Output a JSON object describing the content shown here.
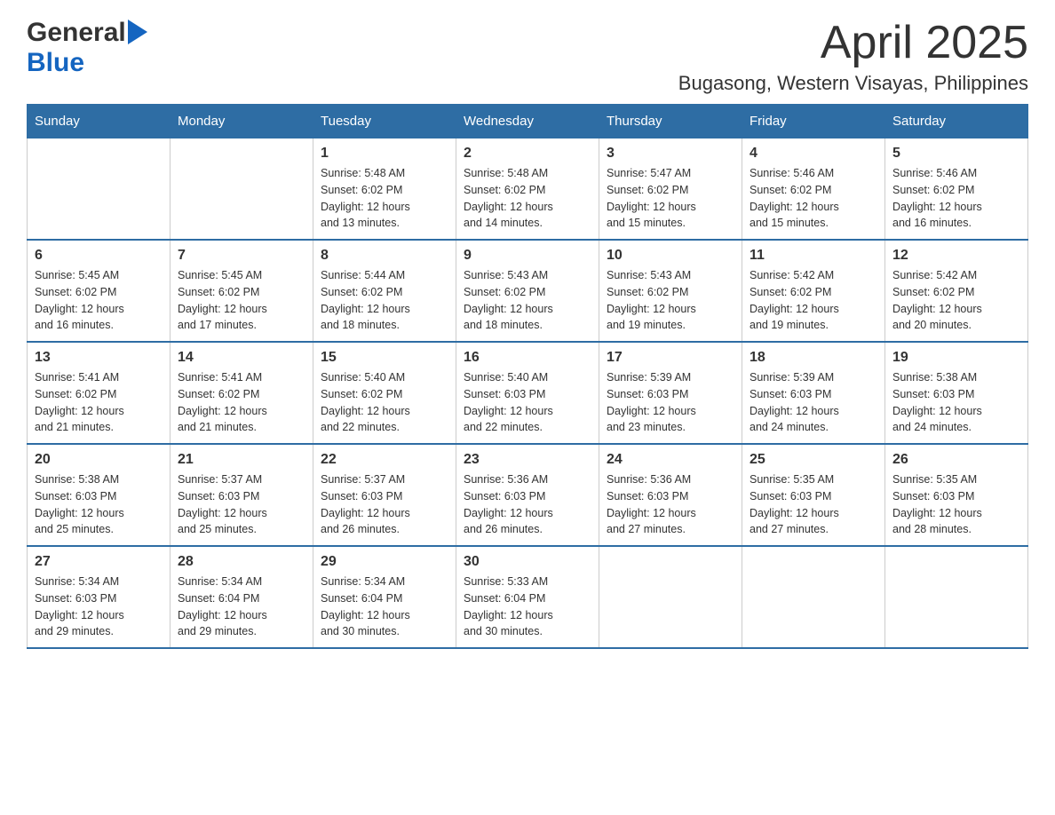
{
  "header": {
    "logo_general": "General",
    "logo_blue": "Blue",
    "title": "April 2025",
    "subtitle": "Bugasong, Western Visayas, Philippines"
  },
  "calendar": {
    "days_of_week": [
      "Sunday",
      "Monday",
      "Tuesday",
      "Wednesday",
      "Thursday",
      "Friday",
      "Saturday"
    ],
    "weeks": [
      [
        {
          "day": "",
          "info": ""
        },
        {
          "day": "",
          "info": ""
        },
        {
          "day": "1",
          "info": "Sunrise: 5:48 AM\nSunset: 6:02 PM\nDaylight: 12 hours\nand 13 minutes."
        },
        {
          "day": "2",
          "info": "Sunrise: 5:48 AM\nSunset: 6:02 PM\nDaylight: 12 hours\nand 14 minutes."
        },
        {
          "day": "3",
          "info": "Sunrise: 5:47 AM\nSunset: 6:02 PM\nDaylight: 12 hours\nand 15 minutes."
        },
        {
          "day": "4",
          "info": "Sunrise: 5:46 AM\nSunset: 6:02 PM\nDaylight: 12 hours\nand 15 minutes."
        },
        {
          "day": "5",
          "info": "Sunrise: 5:46 AM\nSunset: 6:02 PM\nDaylight: 12 hours\nand 16 minutes."
        }
      ],
      [
        {
          "day": "6",
          "info": "Sunrise: 5:45 AM\nSunset: 6:02 PM\nDaylight: 12 hours\nand 16 minutes."
        },
        {
          "day": "7",
          "info": "Sunrise: 5:45 AM\nSunset: 6:02 PM\nDaylight: 12 hours\nand 17 minutes."
        },
        {
          "day": "8",
          "info": "Sunrise: 5:44 AM\nSunset: 6:02 PM\nDaylight: 12 hours\nand 18 minutes."
        },
        {
          "day": "9",
          "info": "Sunrise: 5:43 AM\nSunset: 6:02 PM\nDaylight: 12 hours\nand 18 minutes."
        },
        {
          "day": "10",
          "info": "Sunrise: 5:43 AM\nSunset: 6:02 PM\nDaylight: 12 hours\nand 19 minutes."
        },
        {
          "day": "11",
          "info": "Sunrise: 5:42 AM\nSunset: 6:02 PM\nDaylight: 12 hours\nand 19 minutes."
        },
        {
          "day": "12",
          "info": "Sunrise: 5:42 AM\nSunset: 6:02 PM\nDaylight: 12 hours\nand 20 minutes."
        }
      ],
      [
        {
          "day": "13",
          "info": "Sunrise: 5:41 AM\nSunset: 6:02 PM\nDaylight: 12 hours\nand 21 minutes."
        },
        {
          "day": "14",
          "info": "Sunrise: 5:41 AM\nSunset: 6:02 PM\nDaylight: 12 hours\nand 21 minutes."
        },
        {
          "day": "15",
          "info": "Sunrise: 5:40 AM\nSunset: 6:02 PM\nDaylight: 12 hours\nand 22 minutes."
        },
        {
          "day": "16",
          "info": "Sunrise: 5:40 AM\nSunset: 6:03 PM\nDaylight: 12 hours\nand 22 minutes."
        },
        {
          "day": "17",
          "info": "Sunrise: 5:39 AM\nSunset: 6:03 PM\nDaylight: 12 hours\nand 23 minutes."
        },
        {
          "day": "18",
          "info": "Sunrise: 5:39 AM\nSunset: 6:03 PM\nDaylight: 12 hours\nand 24 minutes."
        },
        {
          "day": "19",
          "info": "Sunrise: 5:38 AM\nSunset: 6:03 PM\nDaylight: 12 hours\nand 24 minutes."
        }
      ],
      [
        {
          "day": "20",
          "info": "Sunrise: 5:38 AM\nSunset: 6:03 PM\nDaylight: 12 hours\nand 25 minutes."
        },
        {
          "day": "21",
          "info": "Sunrise: 5:37 AM\nSunset: 6:03 PM\nDaylight: 12 hours\nand 25 minutes."
        },
        {
          "day": "22",
          "info": "Sunrise: 5:37 AM\nSunset: 6:03 PM\nDaylight: 12 hours\nand 26 minutes."
        },
        {
          "day": "23",
          "info": "Sunrise: 5:36 AM\nSunset: 6:03 PM\nDaylight: 12 hours\nand 26 minutes."
        },
        {
          "day": "24",
          "info": "Sunrise: 5:36 AM\nSunset: 6:03 PM\nDaylight: 12 hours\nand 27 minutes."
        },
        {
          "day": "25",
          "info": "Sunrise: 5:35 AM\nSunset: 6:03 PM\nDaylight: 12 hours\nand 27 minutes."
        },
        {
          "day": "26",
          "info": "Sunrise: 5:35 AM\nSunset: 6:03 PM\nDaylight: 12 hours\nand 28 minutes."
        }
      ],
      [
        {
          "day": "27",
          "info": "Sunrise: 5:34 AM\nSunset: 6:03 PM\nDaylight: 12 hours\nand 29 minutes."
        },
        {
          "day": "28",
          "info": "Sunrise: 5:34 AM\nSunset: 6:04 PM\nDaylight: 12 hours\nand 29 minutes."
        },
        {
          "day": "29",
          "info": "Sunrise: 5:34 AM\nSunset: 6:04 PM\nDaylight: 12 hours\nand 30 minutes."
        },
        {
          "day": "30",
          "info": "Sunrise: 5:33 AM\nSunset: 6:04 PM\nDaylight: 12 hours\nand 30 minutes."
        },
        {
          "day": "",
          "info": ""
        },
        {
          "day": "",
          "info": ""
        },
        {
          "day": "",
          "info": ""
        }
      ]
    ]
  }
}
